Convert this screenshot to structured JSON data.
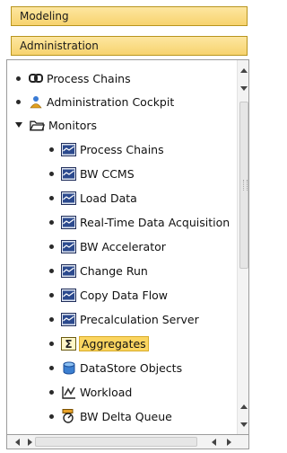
{
  "tabs": [
    {
      "label": "Modeling"
    },
    {
      "label": "Administration"
    }
  ],
  "tree": {
    "items": [
      {
        "label": "Process Chains",
        "icon": "chain-link-icon"
      },
      {
        "label": "Administration Cockpit",
        "icon": "user-person-icon"
      },
      {
        "label": "Monitors",
        "icon": "folder-open-icon"
      },
      {
        "label": "Process Chains",
        "icon": "monitor-icon"
      },
      {
        "label": "BW CCMS",
        "icon": "monitor-icon"
      },
      {
        "label": "Load Data",
        "icon": "monitor-icon"
      },
      {
        "label": "Real-Time Data Acquisition",
        "icon": "monitor-icon"
      },
      {
        "label": "BW Accelerator",
        "icon": "monitor-icon"
      },
      {
        "label": "Change Run",
        "icon": "monitor-icon"
      },
      {
        "label": "Copy Data Flow",
        "icon": "monitor-icon"
      },
      {
        "label": "Precalculation Server",
        "icon": "monitor-icon"
      },
      {
        "label": "Aggregates",
        "icon": "sigma-icon",
        "selected": true
      },
      {
        "label": "DataStore Objects",
        "icon": "database-cylinder-icon"
      },
      {
        "label": "Workload",
        "icon": "chart-graph-icon"
      },
      {
        "label": "BW Delta Queue",
        "icon": "delta-queue-icon"
      }
    ]
  },
  "colors": {
    "tab_fill": "#f7d36e",
    "tab_border": "#b8951e",
    "selection": "#fbd560"
  }
}
